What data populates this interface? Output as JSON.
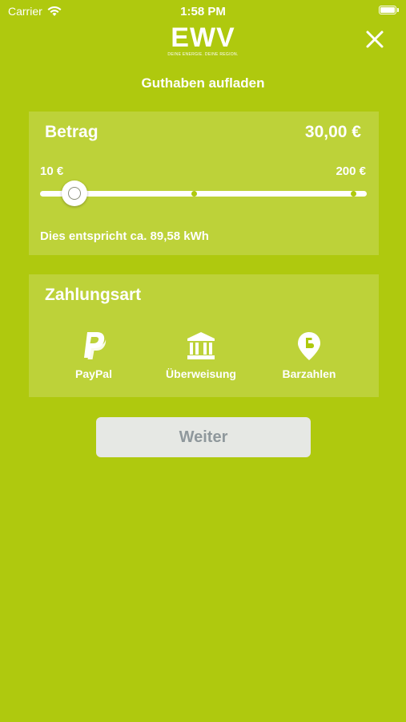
{
  "status_bar": {
    "carrier": "Carrier",
    "time": "1:58 PM"
  },
  "header": {
    "logo_text": "EWV",
    "logo_tagline": "DEINE ENERGIE. DEINE REGION.",
    "title": "Guthaben aufladen"
  },
  "amount": {
    "title": "Betrag",
    "value": "30,00 €",
    "min_label": "10 €",
    "max_label": "200 €",
    "slider_fraction": 0.105,
    "kwh_note": "Dies entspricht ca. 89,58 kWh"
  },
  "payment": {
    "title": "Zahlungsart",
    "options": [
      {
        "label": "PayPal",
        "icon": "paypal-icon"
      },
      {
        "label": "Überweisung",
        "icon": "bank-icon"
      },
      {
        "label": "Barzahlen",
        "icon": "barzahlen-icon"
      }
    ]
  },
  "continue_button": {
    "label": "Weiter"
  },
  "colors": {
    "background": "#afc90e",
    "button_bg": "#e6e8e4",
    "button_text": "#8f989c"
  }
}
